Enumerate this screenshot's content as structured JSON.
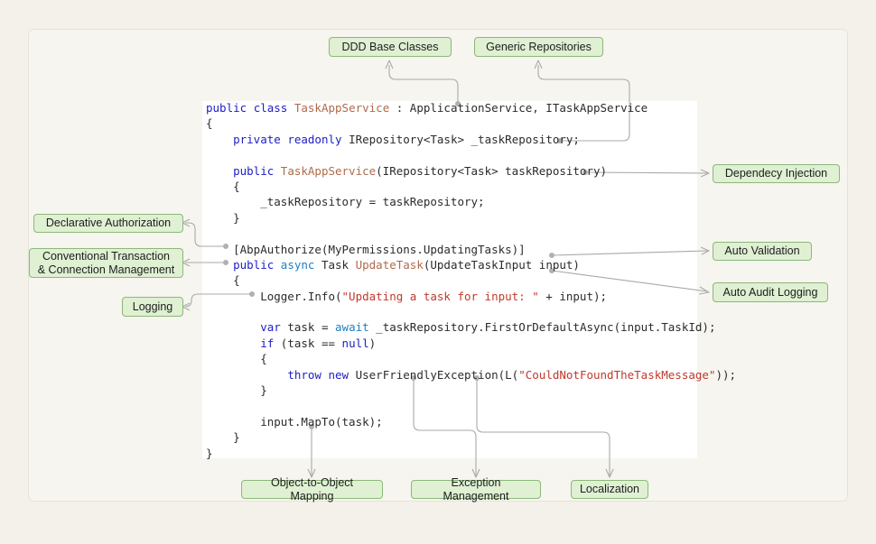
{
  "diagram": {
    "title": "ABP TaskAppService annotated code diagram",
    "colors": {
      "page_background": "#f4f1ea",
      "card_background": "#f7f5ef",
      "code_background": "#ffffff",
      "callout_fill": "#dff0d3",
      "callout_border": "#8cb87a",
      "connector": "#a9a9a9",
      "keyword": "#1d1dc4",
      "keyword_alt": "#1d7fc4",
      "type": "#b06a4a",
      "string": "#c0392b",
      "plain": "#2b2b2b"
    }
  },
  "callouts": {
    "ddd_base_classes": "DDD Base Classes",
    "generic_repositories": "Generic Repositories",
    "dependency_injection": "Dependecy Injection",
    "auto_validation": "Auto Validation",
    "auto_audit_logging": "Auto Audit Logging",
    "declarative_authorization": "Declarative Authorization",
    "conventional_transaction": "Conventional Transaction\n& Connection Management",
    "logging": "Logging",
    "object_to_object_mapping": "Object-to-Object Mapping",
    "exception_management": "Exception Management",
    "localization": "Localization"
  },
  "code": {
    "language": "csharp",
    "lines": [
      [
        {
          "t": "public",
          "c": "kw"
        },
        {
          "t": " ",
          "c": "pln"
        },
        {
          "t": "class",
          "c": "kw"
        },
        {
          "t": " ",
          "c": "pln"
        },
        {
          "t": "TaskAppService",
          "c": "typ"
        },
        {
          "t": " : ApplicationService, ITaskAppService",
          "c": "pln"
        }
      ],
      [
        {
          "t": "{",
          "c": "pln"
        }
      ],
      [
        {
          "t": "    ",
          "c": "pln"
        },
        {
          "t": "private",
          "c": "kw"
        },
        {
          "t": " ",
          "c": "pln"
        },
        {
          "t": "readonly",
          "c": "kw"
        },
        {
          "t": " IRepository<Task> _taskRepository;",
          "c": "pln"
        }
      ],
      [
        {
          "t": "",
          "c": "pln"
        }
      ],
      [
        {
          "t": "    ",
          "c": "pln"
        },
        {
          "t": "public",
          "c": "kw"
        },
        {
          "t": " ",
          "c": "pln"
        },
        {
          "t": "TaskAppService",
          "c": "typ"
        },
        {
          "t": "(IRepository<Task> taskRepository)",
          "c": "pln"
        }
      ],
      [
        {
          "t": "    {",
          "c": "pln"
        }
      ],
      [
        {
          "t": "        _taskRepository = taskRepository;",
          "c": "pln"
        }
      ],
      [
        {
          "t": "    }",
          "c": "pln"
        }
      ],
      [
        {
          "t": "",
          "c": "pln"
        }
      ],
      [
        {
          "t": "    [AbpAuthorize(MyPermissions.UpdatingTasks)]",
          "c": "pln"
        }
      ],
      [
        {
          "t": "    ",
          "c": "pln"
        },
        {
          "t": "public",
          "c": "kw"
        },
        {
          "t": " ",
          "c": "pln"
        },
        {
          "t": "async",
          "c": "kw2"
        },
        {
          "t": " Task ",
          "c": "pln"
        },
        {
          "t": "UpdateTask",
          "c": "typ"
        },
        {
          "t": "(UpdateTaskInput input)",
          "c": "pln"
        }
      ],
      [
        {
          "t": "    {",
          "c": "pln"
        }
      ],
      [
        {
          "t": "        Logger.Info(",
          "c": "pln"
        },
        {
          "t": "\"Updating a task for input: \"",
          "c": "str"
        },
        {
          "t": " + input);",
          "c": "pln"
        }
      ],
      [
        {
          "t": "",
          "c": "pln"
        }
      ],
      [
        {
          "t": "        ",
          "c": "pln"
        },
        {
          "t": "var",
          "c": "kw"
        },
        {
          "t": " task = ",
          "c": "pln"
        },
        {
          "t": "await",
          "c": "kw2"
        },
        {
          "t": " _taskRepository.FirstOrDefaultAsync(input.TaskId);",
          "c": "pln"
        }
      ],
      [
        {
          "t": "        ",
          "c": "pln"
        },
        {
          "t": "if",
          "c": "kw"
        },
        {
          "t": " (task == ",
          "c": "pln"
        },
        {
          "t": "null",
          "c": "kw"
        },
        {
          "t": ")",
          "c": "pln"
        }
      ],
      [
        {
          "t": "        {",
          "c": "pln"
        }
      ],
      [
        {
          "t": "            ",
          "c": "pln"
        },
        {
          "t": "throw",
          "c": "kw"
        },
        {
          "t": " ",
          "c": "pln"
        },
        {
          "t": "new",
          "c": "kw"
        },
        {
          "t": " UserFriendlyException(L(",
          "c": "pln"
        },
        {
          "t": "\"CouldNotFoundTheTaskMessage\"",
          "c": "str"
        },
        {
          "t": "));",
          "c": "pln"
        }
      ],
      [
        {
          "t": "        }",
          "c": "pln"
        }
      ],
      [
        {
          "t": "",
          "c": "pln"
        }
      ],
      [
        {
          "t": "        input.MapTo(task);",
          "c": "pln"
        }
      ],
      [
        {
          "t": "    }",
          "c": "pln"
        }
      ],
      [
        {
          "t": "}",
          "c": "pln"
        }
      ]
    ]
  }
}
